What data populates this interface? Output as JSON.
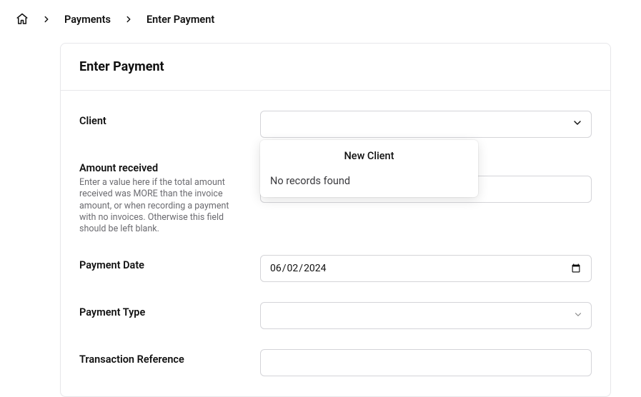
{
  "breadcrumb": {
    "payments": "Payments",
    "enterPayment": "Enter Payment"
  },
  "page": {
    "title": "Enter Payment"
  },
  "form": {
    "client": {
      "label": "Client",
      "value": "",
      "dropdown": {
        "newClient": "New Client",
        "empty": "No records found"
      }
    },
    "amount": {
      "label": "Amount received",
      "help": "Enter a value here if the total amount received was MORE than the invoice amount, or when recording a payment with no invoices. Otherwise this field should be left blank.",
      "value": ""
    },
    "paymentDate": {
      "label": "Payment Date",
      "value": "2024-06-02"
    },
    "paymentType": {
      "label": "Payment Type",
      "value": ""
    },
    "transactionReference": {
      "label": "Transaction Reference",
      "value": ""
    }
  }
}
